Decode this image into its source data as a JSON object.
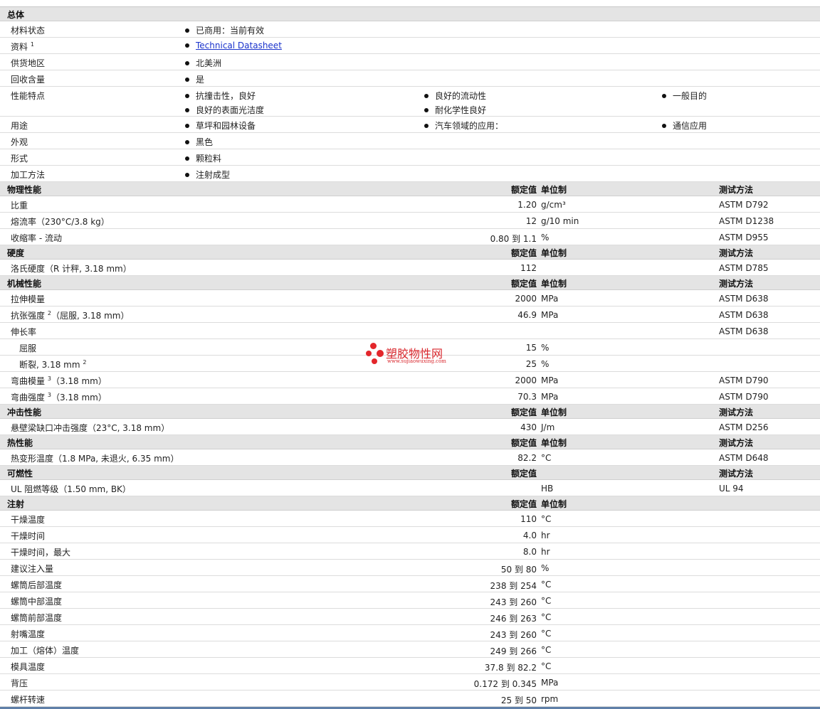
{
  "general": {
    "title": "总体",
    "rows": [
      {
        "label": "材料状态",
        "items": [
          [
            "已商用：当前有效"
          ]
        ]
      },
      {
        "label": "资料",
        "sup": "1",
        "items": [
          [
            "Technical Datasheet"
          ]
        ],
        "link": true
      },
      {
        "label": "供货地区",
        "items": [
          [
            "北美洲"
          ]
        ]
      },
      {
        "label": "回收含量",
        "items": [
          [
            "是"
          ]
        ]
      },
      {
        "label": "性能特点",
        "items": [
          [
            "抗撞击性，良好",
            "良好的流动性",
            "一般目的"
          ],
          [
            "良好的表面光洁度",
            "耐化学性良好"
          ]
        ]
      },
      {
        "label": "用途",
        "items": [
          [
            "草坪和园林设备",
            "汽车领域的应用：",
            "通信应用"
          ]
        ]
      },
      {
        "label": "外观",
        "items": [
          [
            "黑色"
          ]
        ]
      },
      {
        "label": "形式",
        "items": [
          [
            "颗粒料"
          ]
        ]
      },
      {
        "label": "加工方法",
        "items": [
          [
            "注射成型"
          ]
        ]
      }
    ]
  },
  "columns": {
    "nominal": "额定值",
    "unit": "单位制",
    "method": "测试方法"
  },
  "sections": [
    {
      "title": "物理性能",
      "show_unit": true,
      "show_method": true,
      "rows": [
        {
          "label": "比重",
          "value": "1.20",
          "unit": "g/cm³",
          "method": "ASTM D792"
        },
        {
          "label": "熔流率（230°C/3.8 kg）",
          "value": "12",
          "unit": "g/10 min",
          "method": "ASTM D1238"
        },
        {
          "label": "收缩率 - 流动",
          "value": "0.80 到  1.1",
          "unit": "%",
          "method": "ASTM D955"
        }
      ]
    },
    {
      "title": "硬度",
      "show_unit": true,
      "show_method": true,
      "rows": [
        {
          "label": "洛氏硬度（R 计秤, 3.18 mm）",
          "value": "112",
          "unit": "",
          "method": "ASTM D785"
        }
      ]
    },
    {
      "title": "机械性能",
      "show_unit": true,
      "show_method": true,
      "rows": [
        {
          "label": "拉伸模量",
          "value": "2000",
          "unit": "MPa",
          "method": "ASTM D638"
        },
        {
          "label": "抗张强度",
          "sup": "2",
          "label_after": "（屈服, 3.18 mm）",
          "value": "46.9",
          "unit": "MPa",
          "method": "ASTM D638"
        },
        {
          "label": "伸长率",
          "value": "",
          "unit": "",
          "method": "ASTM D638"
        },
        {
          "label": "屈服",
          "sub": true,
          "value": "15",
          "unit": "%",
          "method": ""
        },
        {
          "label": "断裂, 3.18 mm",
          "sub": true,
          "sup": "2",
          "value": "25",
          "unit": "%",
          "method": ""
        },
        {
          "label": "弯曲模量",
          "sup": "3",
          "label_after": "（3.18 mm）",
          "value": "2000",
          "unit": "MPa",
          "method": "ASTM D790"
        },
        {
          "label": "弯曲强度",
          "sup": "3",
          "label_after": "（3.18 mm）",
          "value": "70.3",
          "unit": "MPa",
          "method": "ASTM D790"
        }
      ]
    },
    {
      "title": "冲击性能",
      "show_unit": true,
      "show_method": true,
      "rows": [
        {
          "label": "悬壁梁缺口冲击强度（23°C, 3.18 mm）",
          "value": "430",
          "unit": "J/m",
          "method": "ASTM D256"
        }
      ]
    },
    {
      "title": "热性能",
      "show_unit": true,
      "show_method": true,
      "rows": [
        {
          "label": "热变形温度（1.8 MPa, 未退火, 6.35 mm）",
          "value": "82.2",
          "unit": "°C",
          "method": "ASTM D648"
        }
      ]
    },
    {
      "title": "可燃性",
      "show_unit": false,
      "show_method": true,
      "rows": [
        {
          "label": "UL 阻燃等级（1.50 mm, BK）",
          "value": "",
          "unit": "HB",
          "method": "UL 94"
        }
      ]
    },
    {
      "title": "注射",
      "show_unit": true,
      "show_method": false,
      "rows": [
        {
          "label": "干燥温度",
          "value": "110",
          "unit": "°C",
          "method": ""
        },
        {
          "label": "干燥时间",
          "value": "4.0",
          "unit": "hr",
          "method": ""
        },
        {
          "label": "干燥时间，最大",
          "value": "8.0",
          "unit": "hr",
          "method": ""
        },
        {
          "label": "建议注入量",
          "value": "50 到  80",
          "unit": "%",
          "method": ""
        },
        {
          "label": "螺筒后部温度",
          "value": "238 到  254",
          "unit": "°C",
          "method": ""
        },
        {
          "label": "螺筒中部温度",
          "value": "243 到  260",
          "unit": "°C",
          "method": ""
        },
        {
          "label": "螺筒前部温度",
          "value": "246 到  263",
          "unit": "°C",
          "method": ""
        },
        {
          "label": "射嘴温度",
          "value": "243 到  260",
          "unit": "°C",
          "method": ""
        },
        {
          "label": "加工（熔体）温度",
          "value": "249 到  266",
          "unit": "°C",
          "method": ""
        },
        {
          "label": "模具温度",
          "value": "37.8 到  82.2",
          "unit": "°C",
          "method": ""
        },
        {
          "label": "背压",
          "value": "0.172 到  0.345",
          "unit": "MPa",
          "method": ""
        },
        {
          "label": "螺杆转速",
          "value": "25 到  50",
          "unit": "rpm",
          "method": ""
        }
      ]
    }
  ],
  "watermark": {
    "name": "塑胶物性网",
    "url": "www.sujiaowuxing.com"
  }
}
